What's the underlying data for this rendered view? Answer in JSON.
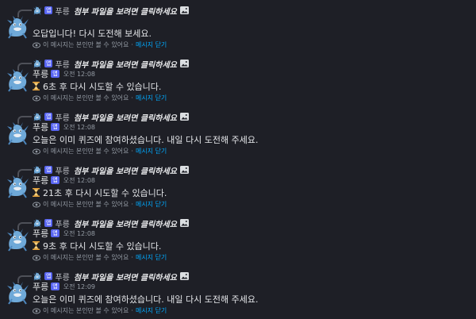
{
  "reply_bar": {
    "name": "푸릉",
    "badge": "앱",
    "text": "첨부 파일을 보려면 클릭하세요"
  },
  "ephemeral": {
    "note": "이 메시지는 본인만 볼 수 있어요",
    "separator": "·",
    "dismiss": "메시지 닫기"
  },
  "messages": [
    {
      "username": "",
      "badge": "",
      "time": "오전 12:08",
      "text": "오답입니다! 다시 도전해 보세요.",
      "hourglass": false
    },
    {
      "username": "푸릉",
      "badge": "앱",
      "time": "오전 12:08",
      "text": "6초 후 다시 시도할 수 있습니다.",
      "hourglass": true
    },
    {
      "username": "푸릉",
      "badge": "앱",
      "time": "오전 12:08",
      "text": "오늘은 이미 퀴즈에 참여하셨습니다. 내일 다시 도전해 주세요.",
      "hourglass": false
    },
    {
      "username": "푸릉",
      "badge": "앱",
      "time": "오전 12:08",
      "text": "21초 후 다시 시도할 수 있습니다.",
      "hourglass": true
    },
    {
      "username": "푸릉",
      "badge": "앱",
      "time": "오전 12:08",
      "text": "9초 후 다시 시도할 수 있습니다.",
      "hourglass": true
    },
    {
      "username": "푸릉",
      "badge": "앱",
      "time": "오전 12:09",
      "text": "오늘은 이미 퀴즈에 참여하셨습니다. 내일 다시 도전해 주세요.",
      "hourglass": false
    }
  ],
  "colors": {
    "background": "#1e1f26",
    "app_badge": "#5865f2",
    "link": "#00a8fc",
    "muted": "#949ba4"
  }
}
